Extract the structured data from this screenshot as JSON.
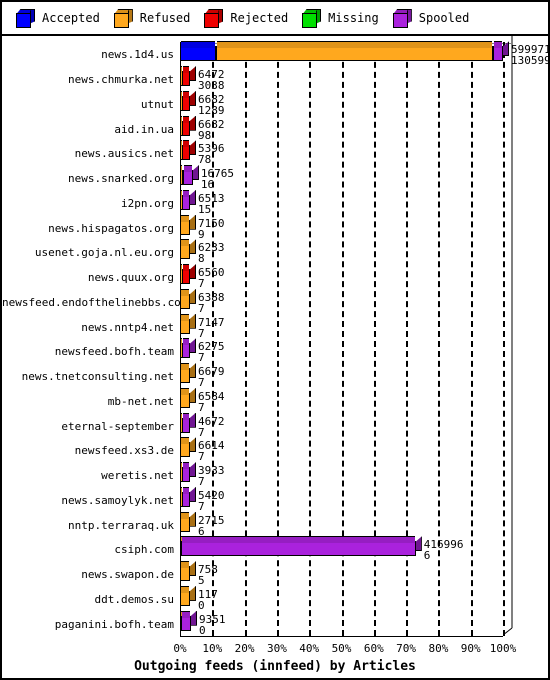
{
  "legend": {
    "items": [
      {
        "label": "Accepted",
        "color": "#0000ff",
        "icon": "cube-icon"
      },
      {
        "label": "Refused",
        "color": "#ffa81e",
        "icon": "cube-icon"
      },
      {
        "label": "Rejected",
        "color": "#ee0000",
        "icon": "cube-icon"
      },
      {
        "label": "Missing",
        "color": "#00e000",
        "icon": "cube-icon"
      },
      {
        "label": "Spooled",
        "color": "#aa22dd",
        "icon": "cube-icon"
      }
    ]
  },
  "chart_data": {
    "type": "bar",
    "orientation": "horizontal",
    "stacked": true,
    "title": "Outgoing feeds (innfeed) by Articles",
    "xlabel": "",
    "ylabel": "",
    "xlim": [
      0,
      100
    ],
    "xunit": "%",
    "grid": true,
    "legend_position": "top",
    "xticks": [
      "0%",
      "10%",
      "20%",
      "30%",
      "40%",
      "50%",
      "60%",
      "70%",
      "80%",
      "90%",
      "100%"
    ],
    "xtick_values": [
      0,
      10,
      20,
      30,
      40,
      50,
      60,
      70,
      80,
      90,
      100
    ],
    "series": [
      {
        "name": "Accepted",
        "color": "#0000ff"
      },
      {
        "name": "Refused",
        "color": "#ffa81e"
      },
      {
        "name": "Rejected",
        "color": "#ee0000"
      },
      {
        "name": "Missing",
        "color": "#00e000"
      },
      {
        "name": "Spooled",
        "color": "#aa22dd"
      }
    ],
    "categories": [
      "news.1d4.us",
      "news.chmurka.net",
      "utnut",
      "aid.in.ua",
      "news.ausics.net",
      "news.snarked.org",
      "i2pn.org",
      "news.hispagatos.org",
      "usenet.goja.nl.eu.org",
      "news.quux.org",
      "newsfeed.endofthelinebbs.com",
      "news.nntp4.net",
      "newsfeed.bofh.team",
      "news.tnetconsulting.net",
      "mb-net.net",
      "eternal-september",
      "newsfeed.xs3.de",
      "weretis.net",
      "news.samoylyk.net",
      "nntp.terraraq.uk",
      "csiph.com",
      "news.swapon.de",
      "ddt.demos.su",
      "paganini.bofh.team"
    ],
    "rows": [
      {
        "label": "news.1d4.us",
        "value_top": "599971",
        "value_bottom": "130599",
        "segments": [
          {
            "series": "Accepted",
            "pct": 11.0
          },
          {
            "series": "Refused",
            "pct": 86.0
          },
          {
            "series": "Spooled",
            "pct": 3.0
          }
        ]
      },
      {
        "label": "news.chmurka.net",
        "value_top": "6472",
        "value_bottom": "3038",
        "segments": [
          {
            "series": "Refused",
            "pct": 0.5
          },
          {
            "series": "Rejected",
            "pct": 2.6
          }
        ]
      },
      {
        "label": "utnut",
        "value_top": "6682",
        "value_bottom": "1289",
        "segments": [
          {
            "series": "Refused",
            "pct": 0.5
          },
          {
            "series": "Rejected",
            "pct": 2.6
          }
        ]
      },
      {
        "label": "aid.in.ua",
        "value_top": "6682",
        "value_bottom": "98",
        "segments": [
          {
            "series": "Refused",
            "pct": 0.5
          },
          {
            "series": "Rejected",
            "pct": 2.6
          }
        ]
      },
      {
        "label": "news.ausics.net",
        "value_top": "5396",
        "value_bottom": "78",
        "segments": [
          {
            "series": "Refused",
            "pct": 0.5
          },
          {
            "series": "Rejected",
            "pct": 2.6
          }
        ]
      },
      {
        "label": "news.snarked.org",
        "value_top": "16765",
        "value_bottom": "16",
        "segments": [
          {
            "series": "Refused",
            "pct": 0.8
          },
          {
            "series": "Spooled",
            "pct": 3.2
          }
        ]
      },
      {
        "label": "i2pn.org",
        "value_top": "6513",
        "value_bottom": "15",
        "segments": [
          {
            "series": "Refused",
            "pct": 0.5
          },
          {
            "series": "Spooled",
            "pct": 2.6
          }
        ]
      },
      {
        "label": "news.hispagatos.org",
        "value_top": "7150",
        "value_bottom": "9",
        "segments": [
          {
            "series": "Refused",
            "pct": 3.1
          }
        ]
      },
      {
        "label": "usenet.goja.nl.eu.org",
        "value_top": "6233",
        "value_bottom": "8",
        "segments": [
          {
            "series": "Refused",
            "pct": 3.1
          }
        ]
      },
      {
        "label": "news.quux.org",
        "value_top": "6560",
        "value_bottom": "7",
        "segments": [
          {
            "series": "Refused",
            "pct": 0.5
          },
          {
            "series": "Rejected",
            "pct": 2.6
          }
        ]
      },
      {
        "label": "newsfeed.endofthelinebbs.com",
        "value_top": "6388",
        "value_bottom": "7",
        "segments": [
          {
            "series": "Refused",
            "pct": 3.1
          }
        ]
      },
      {
        "label": "news.nntp4.net",
        "value_top": "7147",
        "value_bottom": "7",
        "segments": [
          {
            "series": "Refused",
            "pct": 3.1
          }
        ]
      },
      {
        "label": "newsfeed.bofh.team",
        "value_top": "6275",
        "value_bottom": "7",
        "segments": [
          {
            "series": "Refused",
            "pct": 0.5
          },
          {
            "series": "Spooled",
            "pct": 2.6
          }
        ]
      },
      {
        "label": "news.tnetconsulting.net",
        "value_top": "6679",
        "value_bottom": "7",
        "segments": [
          {
            "series": "Refused",
            "pct": 3.1
          }
        ]
      },
      {
        "label": "mb-net.net",
        "value_top": "6584",
        "value_bottom": "7",
        "segments": [
          {
            "series": "Refused",
            "pct": 3.1
          }
        ]
      },
      {
        "label": "eternal-september",
        "value_top": "4672",
        "value_bottom": "7",
        "segments": [
          {
            "series": "Refused",
            "pct": 0.5
          },
          {
            "series": "Spooled",
            "pct": 2.6
          }
        ]
      },
      {
        "label": "newsfeed.xs3.de",
        "value_top": "6614",
        "value_bottom": "7",
        "segments": [
          {
            "series": "Refused",
            "pct": 3.1
          }
        ]
      },
      {
        "label": "weretis.net",
        "value_top": "3933",
        "value_bottom": "7",
        "segments": [
          {
            "series": "Refused",
            "pct": 0.5
          },
          {
            "series": "Spooled",
            "pct": 2.6
          }
        ]
      },
      {
        "label": "news.samoylyk.net",
        "value_top": "5420",
        "value_bottom": "7",
        "segments": [
          {
            "series": "Refused",
            "pct": 0.5
          },
          {
            "series": "Spooled",
            "pct": 2.6
          }
        ]
      },
      {
        "label": "nntp.terraraq.uk",
        "value_top": "2715",
        "value_bottom": "6",
        "segments": [
          {
            "series": "Refused",
            "pct": 3.1
          }
        ]
      },
      {
        "label": "csiph.com",
        "value_top": "416996",
        "value_bottom": "6",
        "segments": [
          {
            "series": "Refused",
            "pct": 0.4
          },
          {
            "series": "Spooled",
            "pct": 72.6
          }
        ]
      },
      {
        "label": "news.swapon.de",
        "value_top": "758",
        "value_bottom": "5",
        "segments": [
          {
            "series": "Refused",
            "pct": 3.1
          }
        ]
      },
      {
        "label": "ddt.demos.su",
        "value_top": "117",
        "value_bottom": "0",
        "segments": [
          {
            "series": "Refused",
            "pct": 3.1
          }
        ]
      },
      {
        "label": "paganini.bofh.team",
        "value_top": "9351",
        "value_bottom": "0",
        "segments": [
          {
            "series": "Refused",
            "pct": 0.4
          },
          {
            "series": "Spooled",
            "pct": 3.0
          }
        ]
      }
    ]
  }
}
